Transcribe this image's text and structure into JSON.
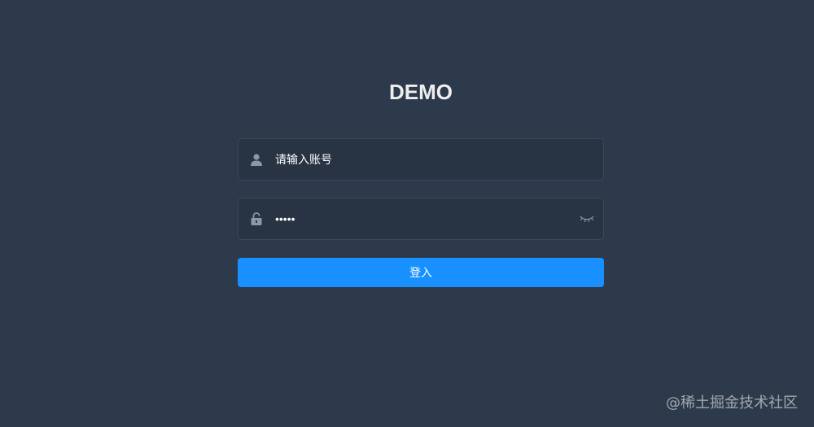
{
  "login": {
    "title": "DEMO",
    "username": {
      "placeholder": "请输入账号",
      "icon": "user-icon"
    },
    "password": {
      "value_masked": "•••••",
      "icon": "lock-icon",
      "toggle_icon": "eye-closed-icon"
    },
    "submit_label": "登入"
  },
  "watermark": "@稀土掘金技术社区",
  "colors": {
    "background": "#2d3a4b",
    "accent": "#1890ff",
    "title": "#eeeeee"
  }
}
